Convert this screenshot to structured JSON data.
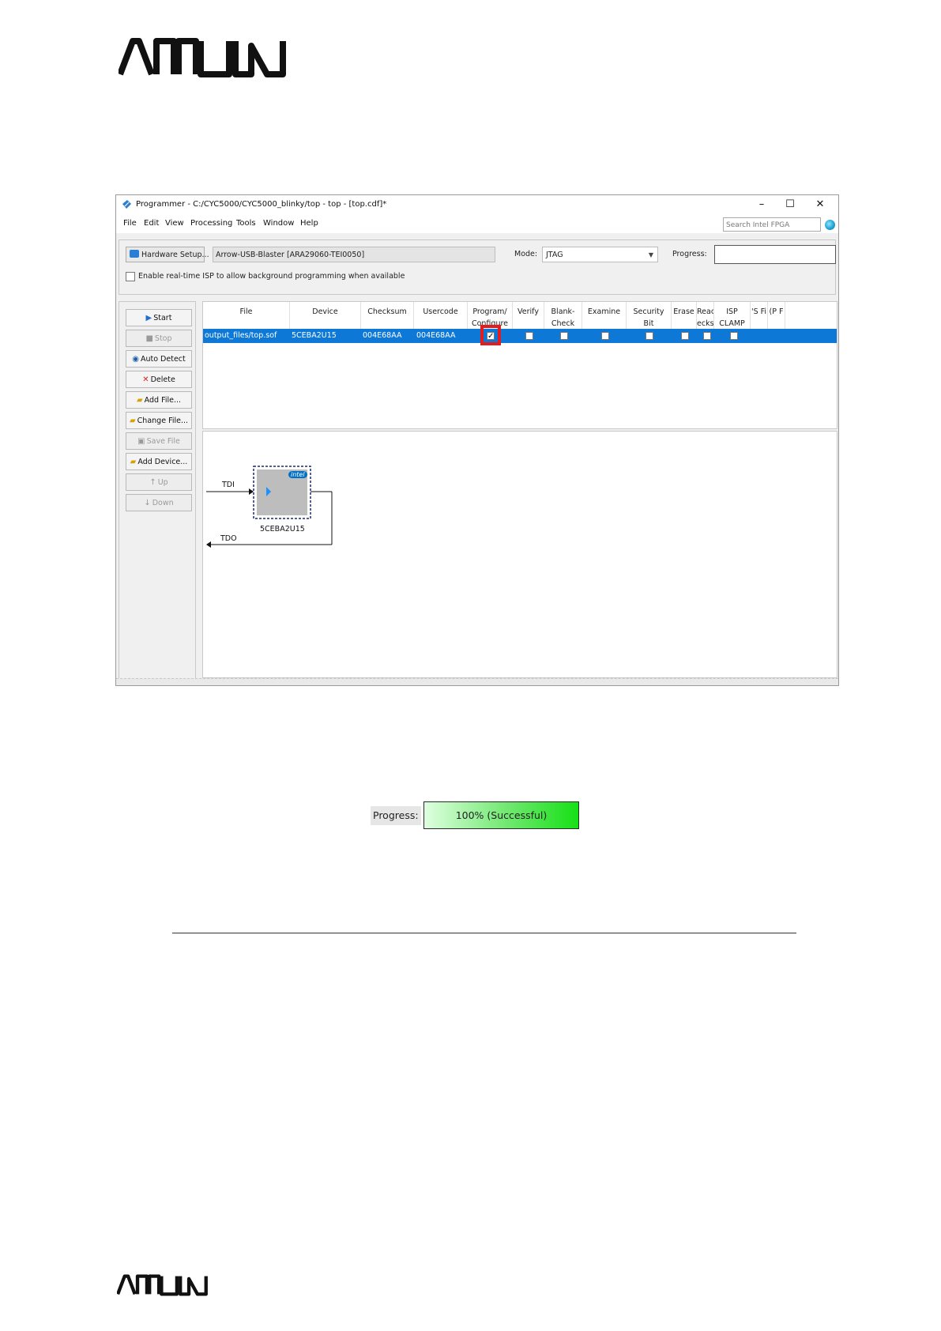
{
  "branding": {
    "logo_text": "ARROW"
  },
  "window": {
    "title": "Programmer - C:/CYC5000/CYC5000_blinky/top - top - [top.cdf]*",
    "controls": {
      "minimize": "–",
      "maximize": "☐",
      "close": "✕"
    },
    "menu": [
      "File",
      "Edit",
      "View",
      "Processing",
      "Tools",
      "Window",
      "Help"
    ],
    "search_placeholder": "Search Intel FPGA"
  },
  "hardware": {
    "setup_button": "Hardware Setup...",
    "device": "Arrow-USB-Blaster [ARA29060-TEI0050]",
    "mode_label": "Mode:",
    "mode_value": "JTAG",
    "progress_label": "Progress:",
    "isp_label": "Enable real-time ISP to allow background programming when available"
  },
  "sidebar": {
    "buttons": [
      {
        "label": "Start",
        "enabled": true
      },
      {
        "label": "Stop",
        "enabled": false
      },
      {
        "label": "Auto Detect",
        "enabled": true
      },
      {
        "label": "Delete",
        "enabled": true
      },
      {
        "label": "Add File...",
        "enabled": true
      },
      {
        "label": "Change File...",
        "enabled": true
      },
      {
        "label": "Save File",
        "enabled": false
      },
      {
        "label": "Add Device...",
        "enabled": true
      },
      {
        "label": "Up",
        "enabled": false
      },
      {
        "label": "Down",
        "enabled": false
      }
    ]
  },
  "table": {
    "headers": [
      "File",
      "Device",
      "Checksum",
      "Usercode",
      "Program/\nConfigure",
      "Verify",
      "Blank-\nCheck",
      "Examine",
      "Security\nBit",
      "Erase",
      "Reac\necks",
      "ISP\nCLAMP",
      "'S Fi",
      "(P F"
    ],
    "row": {
      "file": "output_files/top.sof",
      "device": "5CEBA2U15",
      "checksum": "004E68AA",
      "usercode": "004E68AA",
      "program_configure": true,
      "verify": false,
      "blank_check": false,
      "examine": false,
      "security_bit": false,
      "erase": false,
      "read_checks": false,
      "isp_clamp": false
    }
  },
  "diagram": {
    "tdi": "TDI",
    "tdo": "TDO",
    "chip_label": "5CEBA2U15",
    "chip_brand": "intel"
  },
  "progress_demo": {
    "label": "Progress:",
    "value": "100% (Successful)",
    "percent": 100
  }
}
